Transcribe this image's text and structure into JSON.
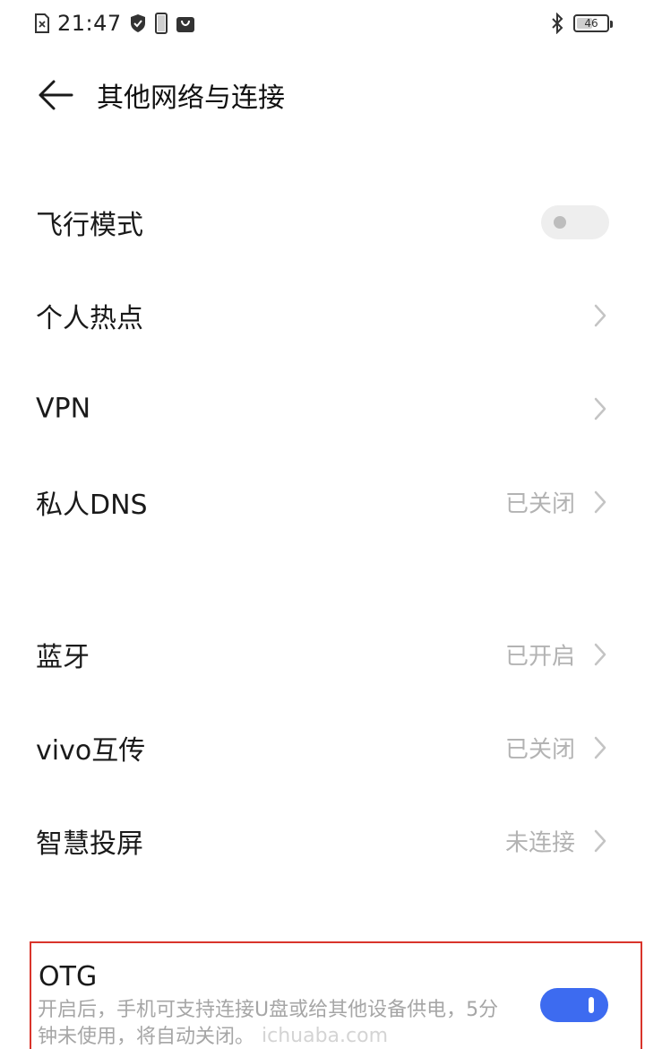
{
  "status_bar": {
    "time": "21:47",
    "battery_level": "46",
    "icons": [
      "sim-error-icon",
      "shield-icon",
      "phone-outline-icon",
      "shopping-bag-icon",
      "bluetooth-icon",
      "battery-icon"
    ]
  },
  "header": {
    "title": "其他网络与连接",
    "back_icon": "back-arrow-icon"
  },
  "rows": [
    {
      "label": "飞行模式",
      "control": "toggle",
      "state": "off"
    },
    {
      "label": "个人热点",
      "control": "chevron"
    },
    {
      "label": "VPN",
      "control": "chevron"
    },
    {
      "label": "私人DNS",
      "value": "已关闭",
      "control": "chevron"
    },
    {
      "label": "蓝牙",
      "value": "已开启",
      "control": "chevron"
    },
    {
      "label": "vivo互传",
      "value": "已关闭",
      "control": "chevron"
    },
    {
      "label": "智慧投屏",
      "value": "未连接",
      "control": "chevron"
    }
  ],
  "otg": {
    "title": "OTG",
    "description": "开启后，手机可支持连接U盘或给其他设备供电，5分钟未使用，将自动关闭。",
    "state": "on",
    "highlight_color": "#d9342b"
  },
  "colors": {
    "accent": "#3d6bf0",
    "secondary_text": "#b3b3b3"
  },
  "watermark": "ichuaba.com"
}
